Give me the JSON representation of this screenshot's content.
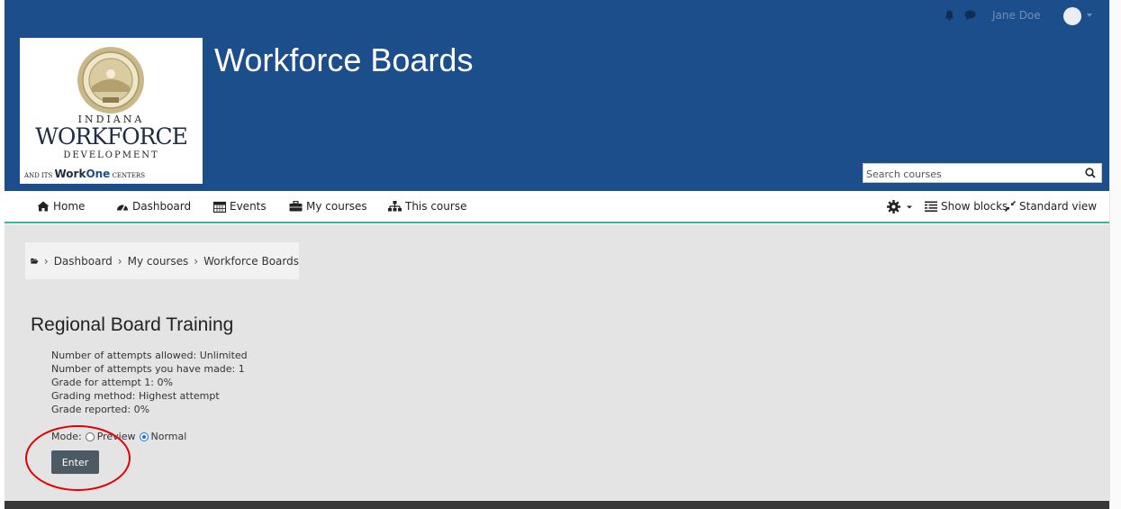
{
  "topbar": {
    "user_name": "Jane Doe"
  },
  "header": {
    "site_title": "Workforce Boards",
    "logo": {
      "line1": "INDIANA",
      "line2": "WORKFORCE",
      "line3": "DEVELOPMENT",
      "line4_prefix": "AND ITS",
      "line4_brand_work": "Work",
      "line4_brand_one": "One",
      "line4_suffix": "CENTERS"
    },
    "search_placeholder": "Search courses"
  },
  "nav": {
    "items": [
      {
        "label": "Home",
        "icon": "home-icon"
      },
      {
        "label": "Dashboard",
        "icon": "dashboard-icon"
      },
      {
        "label": "Events",
        "icon": "calendar-icon"
      },
      {
        "label": "My courses",
        "icon": "briefcase-icon"
      },
      {
        "label": "This course",
        "icon": "sitemap-icon"
      }
    ],
    "show_blocks": "Show blocks",
    "standard_view": "Standard view"
  },
  "breadcrumb": [
    "Dashboard",
    "My courses",
    "Workforce Boards"
  ],
  "page": {
    "title": "Regional Board Training",
    "info": [
      "Number of attempts allowed: Unlimited",
      "Number of attempts you have made: 1",
      "Grade for attempt 1: 0%",
      "Grading method: Highest attempt",
      "Grade reported: 0%"
    ],
    "mode_label": "Mode:",
    "mode_options": [
      {
        "label": "Preview",
        "selected": false
      },
      {
        "label": "Normal",
        "selected": true
      }
    ],
    "enter_label": "Enter"
  },
  "colors": {
    "header_bg": "#1c4e8c",
    "nav_accent": "#3bb1a6",
    "button_bg": "#4c5b63",
    "highlight": "#e00000"
  }
}
